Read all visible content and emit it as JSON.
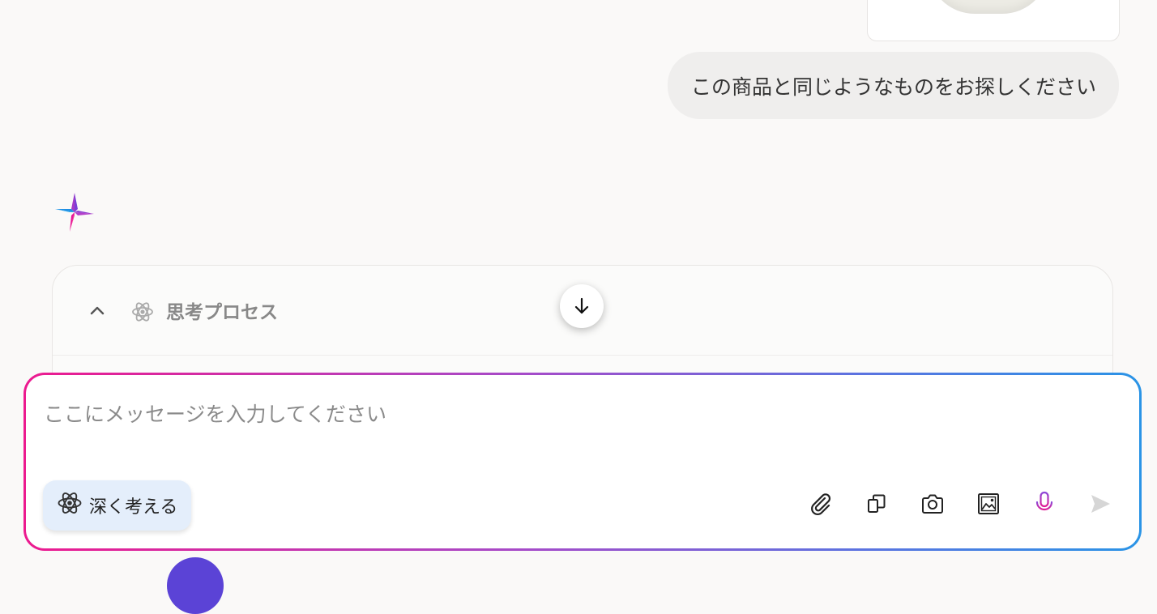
{
  "conversation": {
    "user_message": "この商品と同じようなものをお探しください"
  },
  "thinking": {
    "label": "思考プロセス"
  },
  "composer": {
    "placeholder": "ここにメッセージを入力してください",
    "deep_think_label": "深く考える",
    "tools": [
      {
        "name": "attach-icon"
      },
      {
        "name": "copy-icon"
      },
      {
        "name": "camera-icon"
      },
      {
        "name": "image-icon"
      },
      {
        "name": "microphone-icon"
      },
      {
        "name": "send-icon"
      }
    ]
  },
  "colors": {
    "accent_pink": "#ec1a8f",
    "accent_blue": "#2a94e6",
    "mic_color": "#b13fd0",
    "deep_think_bg": "#e4eefb"
  }
}
